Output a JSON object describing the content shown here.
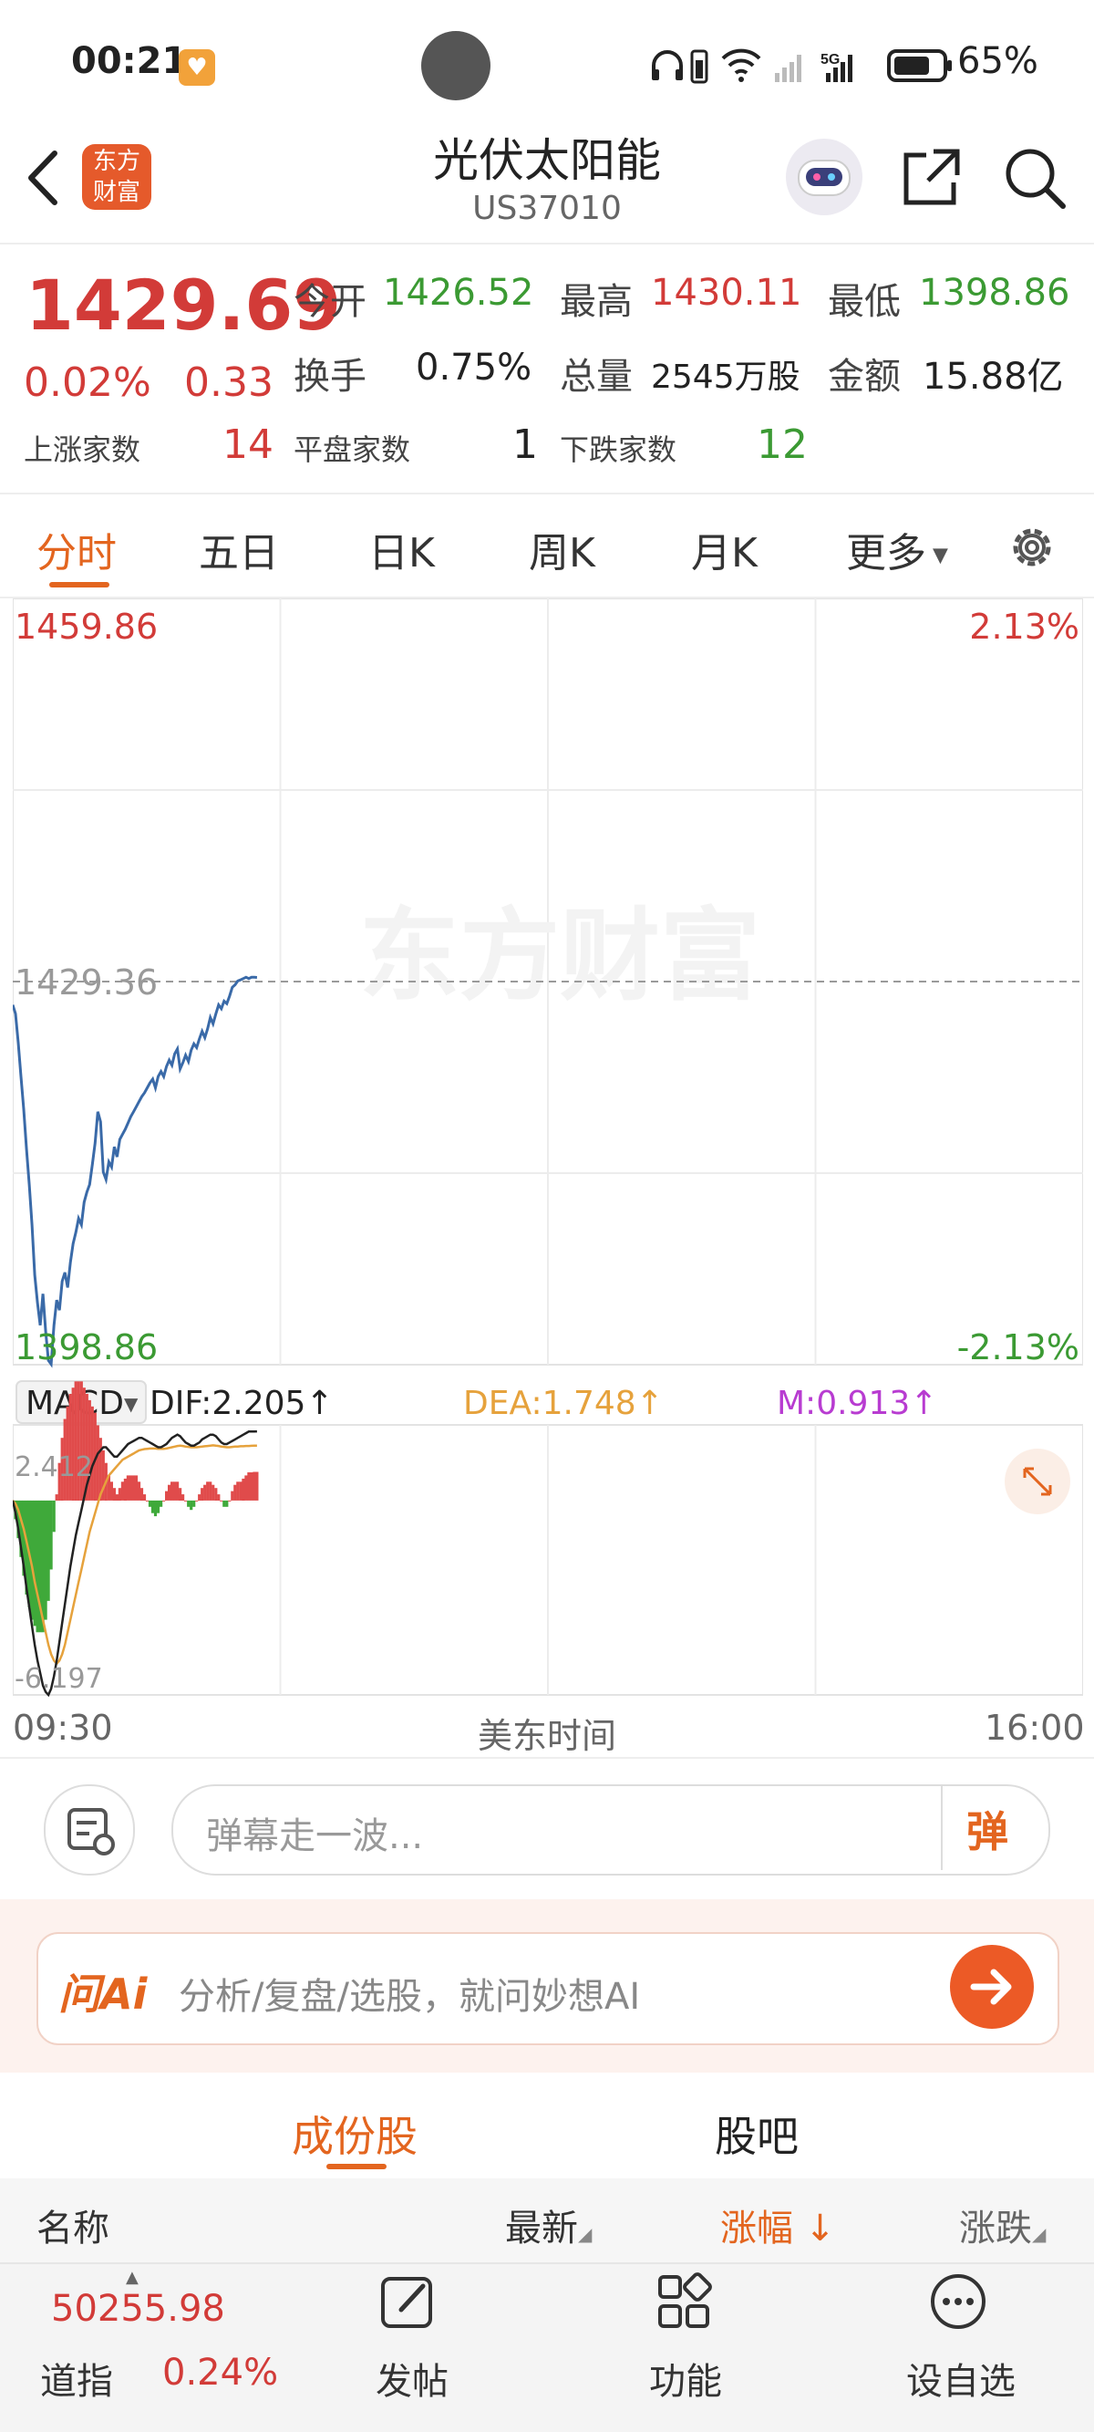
{
  "status_bar": {
    "time": "00:21",
    "battery_pct": "65%",
    "network": "5G",
    "icons": [
      "heart-badge-icon",
      "headphones-icon",
      "wifi-icon",
      "signal-icon",
      "battery-icon"
    ]
  },
  "header": {
    "title": "光伏太阳能",
    "code": "US37010",
    "logo_text": "东方财富",
    "back_icon": "chevron-left-icon",
    "share_icon": "share-icon",
    "search_icon": "search-icon",
    "assistant_icon": "robot-icon"
  },
  "quote": {
    "price": "1429.69",
    "change_pct": "0.02%",
    "change": "0.33",
    "open_label": "今开",
    "open": "1426.52",
    "high_label": "最高",
    "high": "1430.11",
    "low_label": "最低",
    "low": "1398.86",
    "turnover_label": "换手",
    "turnover": "0.75%",
    "volume_label": "总量",
    "volume": "2545万股",
    "amount_label": "金额",
    "amount": "15.88亿",
    "up_label": "上涨家数",
    "up_count": "14",
    "flat_label": "平盘家数",
    "flat_count": "1",
    "down_label": "下跌家数",
    "down_count": "12"
  },
  "tabs": {
    "items": [
      "分时",
      "五日",
      "日K",
      "周K",
      "月K",
      "更多"
    ],
    "active": "分时",
    "settings_icon": "gear-icon"
  },
  "chart_data": {
    "type": "line",
    "title": "",
    "xlabel": "美东时间",
    "x_start": "09:30",
    "x_end": "16:00",
    "y_max_label": "1459.86",
    "y_min_label": "1398.86",
    "ref_label": "1429.36",
    "pct_max_label": "2.13%",
    "pct_min_label": "-2.13%",
    "watermark": "东方财富",
    "ylim": [
      1398.86,
      1459.86
    ],
    "reference": 1429.36,
    "x_minutes_from_open": [
      0,
      1,
      2,
      3,
      4,
      5,
      6,
      7,
      8,
      9,
      10,
      11,
      12,
      13,
      14,
      15,
      16,
      17,
      18,
      19,
      20,
      21,
      22,
      23,
      24,
      25,
      26,
      27,
      28,
      29,
      30,
      31,
      32,
      33,
      34,
      35,
      36,
      37,
      38,
      39,
      40,
      41,
      42,
      43,
      44,
      45,
      46,
      47,
      48,
      49,
      50,
      51,
      52,
      53,
      54,
      55,
      56,
      57,
      58,
      59,
      60,
      61,
      62,
      63,
      64,
      65,
      66,
      67,
      68,
      69,
      70,
      71,
      72,
      73,
      74,
      75,
      76,
      77,
      78,
      79,
      80,
      81,
      82,
      83,
      84,
      85,
      86,
      87,
      88,
      89
    ],
    "price": [
      1427.5,
      1426.8,
      1424.5,
      1421.8,
      1419.2,
      1416.0,
      1413.2,
      1410.0,
      1406.0,
      1403.8,
      1402.0,
      1404.5,
      1401.5,
      1399.2,
      1398.9,
      1402.0,
      1404.0,
      1403.2,
      1405.5,
      1406.2,
      1405.0,
      1407.0,
      1408.5,
      1409.4,
      1410.5,
      1410.0,
      1411.8,
      1412.6,
      1413.2,
      1414.8,
      1416.5,
      1419.0,
      1418.2,
      1414.2,
      1413.6,
      1415.0,
      1414.6,
      1416.2,
      1415.4,
      1416.8,
      1417.2,
      1417.6,
      1418.1,
      1418.6,
      1419.0,
      1419.4,
      1419.8,
      1420.2,
      1420.5,
      1420.9,
      1421.3,
      1421.6,
      1420.9,
      1421.8,
      1422.2,
      1421.8,
      1422.6,
      1423.1,
      1422.7,
      1423.6,
      1424.0,
      1422.4,
      1422.9,
      1423.5,
      1423.0,
      1423.9,
      1424.4,
      1424.1,
      1424.8,
      1425.4,
      1424.9,
      1425.6,
      1426.5,
      1426.0,
      1426.8,
      1427.5,
      1427.2,
      1427.8,
      1427.6,
      1428.2,
      1428.9,
      1429.1,
      1429.4,
      1429.5,
      1429.6,
      1429.7,
      1429.6,
      1429.7,
      1429.7,
      1429.69
    ],
    "macd": {
      "dif_label": "DIF:2.205↑",
      "dea_label": "DEA:1.748↑",
      "m_label": "M:0.913↑",
      "selector": "MACD",
      "top_label": "2.412",
      "bottom_label": "-6.197",
      "ylim": [
        -6.197,
        2.412
      ],
      "dif": [
        0.0,
        -0.4,
        -0.9,
        -1.5,
        -2.1,
        -2.8,
        -3.4,
        -4.0,
        -4.6,
        -5.1,
        -5.5,
        -5.9,
        -6.1,
        -6.197,
        -6.0,
        -5.6,
        -5.1,
        -4.5,
        -3.9,
        -3.3,
        -2.7,
        -2.1,
        -1.6,
        -1.1,
        -0.7,
        -0.3,
        0.1,
        0.5,
        0.8,
        1.1,
        1.3,
        1.5,
        1.6,
        1.7,
        1.7,
        1.6,
        1.5,
        1.4,
        1.4,
        1.5,
        1.6,
        1.7,
        1.8,
        1.85,
        1.9,
        1.95,
        2.0,
        2.0,
        1.95,
        1.9,
        1.85,
        1.8,
        1.75,
        1.7,
        1.7,
        1.75,
        1.8,
        1.9,
        2.0,
        2.05,
        2.1,
        2.05,
        1.95,
        1.85,
        1.8,
        1.75,
        1.75,
        1.8,
        1.85,
        1.95,
        2.0,
        2.05,
        2.1,
        2.1,
        2.05,
        1.95,
        1.85,
        1.8,
        1.8,
        1.85,
        1.9,
        1.95,
        2.0,
        2.05,
        2.1,
        2.15,
        2.2,
        2.2,
        2.2,
        2.205
      ],
      "dea": [
        0.0,
        -0.1,
        -0.3,
        -0.6,
        -0.9,
        -1.3,
        -1.7,
        -2.1,
        -2.6,
        -3.0,
        -3.4,
        -3.8,
        -4.2,
        -4.6,
        -4.9,
        -5.1,
        -5.2,
        -5.1,
        -4.9,
        -4.6,
        -4.2,
        -3.8,
        -3.4,
        -3.0,
        -2.6,
        -2.2,
        -1.8,
        -1.4,
        -1.0,
        -0.7,
        -0.4,
        -0.1,
        0.2,
        0.4,
        0.6,
        0.8,
        0.9,
        1.0,
        1.1,
        1.2,
        1.3,
        1.35,
        1.4,
        1.45,
        1.5,
        1.55,
        1.6,
        1.62,
        1.64,
        1.65,
        1.66,
        1.66,
        1.66,
        1.65,
        1.65,
        1.65,
        1.66,
        1.68,
        1.7,
        1.72,
        1.74,
        1.75,
        1.74,
        1.72,
        1.71,
        1.7,
        1.7,
        1.7,
        1.71,
        1.72,
        1.73,
        1.74,
        1.75,
        1.76,
        1.75,
        1.74,
        1.72,
        1.71,
        1.7,
        1.7,
        1.71,
        1.72,
        1.72,
        1.73,
        1.73,
        1.74,
        1.74,
        1.745,
        1.748,
        1.748
      ],
      "hist": [
        0.0,
        -0.6,
        -1.2,
        -1.8,
        -2.4,
        -3.0,
        -3.4,
        -3.8,
        -4.0,
        -4.2,
        -4.2,
        -4.2,
        -3.8,
        -3.2,
        -2.2,
        -1.0,
        0.2,
        1.2,
        2.0,
        2.6,
        3.0,
        3.4,
        3.6,
        3.8,
        3.8,
        3.8,
        3.6,
        3.4,
        3.2,
        3.0,
        2.8,
        2.4,
        2.0,
        1.6,
        1.2,
        0.8,
        0.6,
        0.4,
        0.2,
        0.4,
        0.6,
        0.7,
        0.8,
        0.8,
        0.8,
        0.8,
        0.6,
        0.4,
        0.2,
        0.0,
        -0.2,
        -0.4,
        -0.5,
        -0.4,
        -0.2,
        0.0,
        0.3,
        0.5,
        0.6,
        0.6,
        0.6,
        0.4,
        0.2,
        0.0,
        -0.2,
        -0.3,
        -0.2,
        0.0,
        0.2,
        0.4,
        0.5,
        0.6,
        0.6,
        0.5,
        0.4,
        0.2,
        0.0,
        -0.2,
        -0.2,
        0.0,
        0.3,
        0.5,
        0.6,
        0.6,
        0.7,
        0.8,
        0.9,
        0.9,
        0.913,
        0.913
      ]
    },
    "x_domain": [
      0,
      390
    ],
    "grid": true,
    "colors": {
      "line": "#3a6aa8",
      "ref": "#9a9a9a",
      "dif": "#222222",
      "dea": "#e6a23c",
      "up": "#e04b4b",
      "down": "#3fa93a"
    }
  },
  "comment_bar": {
    "placeholder": "弹幕走一波...",
    "danmu_label": "弹",
    "compose_icon": "danmu-compose-icon"
  },
  "ai_bar": {
    "logo": "问Ai",
    "placeholder": "分析/复盘/选股，就问妙想AI",
    "arrow_icon": "arrow-right-icon"
  },
  "sub_tabs": {
    "items": [
      "成份股",
      "股吧"
    ],
    "active": "成份股"
  },
  "table_header": {
    "name": "名称",
    "latest": "最新",
    "change_pct": "涨幅",
    "change": "涨跌"
  },
  "bottom_nav": {
    "index_value": "50255.98",
    "index_name": "道指",
    "index_pct": "0.24%",
    "post": "发帖",
    "functions": "功能",
    "watchlist": "设自选"
  }
}
